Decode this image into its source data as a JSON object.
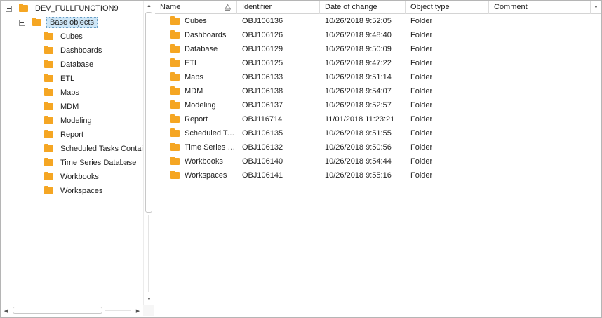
{
  "tree": {
    "root": {
      "label": "DEV_FULLFUNCTION9"
    },
    "base": {
      "label": "Base objects"
    },
    "items": [
      {
        "label": "Cubes"
      },
      {
        "label": "Dashboards"
      },
      {
        "label": "Database"
      },
      {
        "label": "ETL"
      },
      {
        "label": "Maps"
      },
      {
        "label": "MDM"
      },
      {
        "label": "Modeling"
      },
      {
        "label": "Report"
      },
      {
        "label": "Scheduled Tasks Contai"
      },
      {
        "label": "Time Series Database"
      },
      {
        "label": "Workbooks"
      },
      {
        "label": "Workspaces"
      }
    ]
  },
  "list": {
    "columns": {
      "name": "Name",
      "identifier": "Identifier",
      "date": "Date of change",
      "type": "Object type",
      "comment": "Comment"
    },
    "rows": [
      {
        "name": "Cubes",
        "id": "OBJ106136",
        "date": "10/26/2018 9:52:05",
        "type": "Folder"
      },
      {
        "name": "Dashboards",
        "id": "OBJ106126",
        "date": "10/26/2018 9:48:40",
        "type": "Folder"
      },
      {
        "name": "Database",
        "id": "OBJ106129",
        "date": "10/26/2018 9:50:09",
        "type": "Folder"
      },
      {
        "name": "ETL",
        "id": "OBJ106125",
        "date": "10/26/2018 9:47:22",
        "type": "Folder"
      },
      {
        "name": "Maps",
        "id": "OBJ106133",
        "date": "10/26/2018 9:51:14",
        "type": "Folder"
      },
      {
        "name": "MDM",
        "id": "OBJ106138",
        "date": "10/26/2018 9:54:07",
        "type": "Folder"
      },
      {
        "name": "Modeling",
        "id": "OBJ106137",
        "date": "10/26/2018 9:52:57",
        "type": "Folder"
      },
      {
        "name": "Report",
        "id": "OBJ116714",
        "date": "11/01/2018 11:23:21",
        "type": "Folder"
      },
      {
        "name": "Scheduled Ta…",
        "id": "OBJ106135",
        "date": "10/26/2018 9:51:55",
        "type": "Folder"
      },
      {
        "name": "Time Series …",
        "id": "OBJ106132",
        "date": "10/26/2018 9:50:56",
        "type": "Folder"
      },
      {
        "name": "Workbooks",
        "id": "OBJ106140",
        "date": "10/26/2018 9:54:44",
        "type": "Folder"
      },
      {
        "name": "Workspaces",
        "id": "OBJ106141",
        "date": "10/26/2018 9:55:16",
        "type": "Folder"
      }
    ]
  },
  "icons": {
    "folder": "folder-icon",
    "collapse": "collapse-icon",
    "sort": "sort-ascending-icon"
  },
  "colors": {
    "folder": "#f5a623",
    "selection": "#cde6f7"
  }
}
